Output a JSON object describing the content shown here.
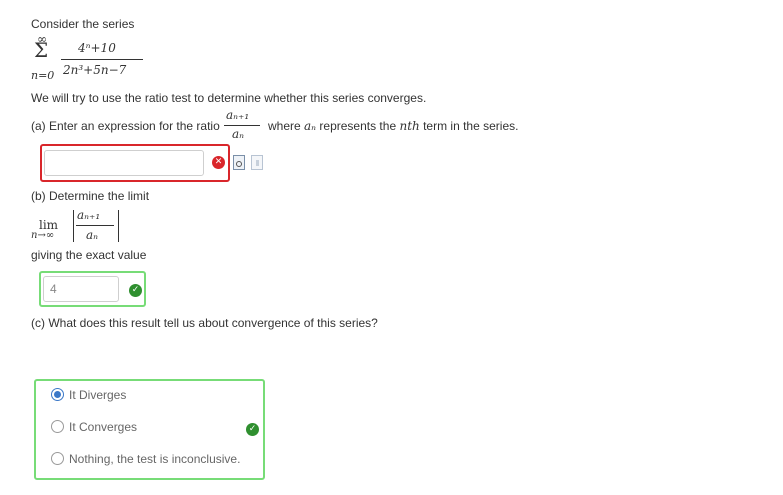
{
  "intro": "Consider the series",
  "series": {
    "sum_top": "∞",
    "sum_symbol": "Σ",
    "sum_bottom": "n=0",
    "numerator": "4ⁿ+10",
    "denominator": "2n³+5n−7"
  },
  "instructions": "We will try to use the ratio test to determine whether this series converges.",
  "part_a": {
    "text_before": "(a) Enter an expression for the ratio",
    "ratio_num": "aₙ₊₁",
    "ratio_den": "aₙ",
    "text_after_1": "where",
    "a_n": "aₙ",
    "text_after_2": "represents the",
    "nth": "nth",
    "text_after_3": "term in the series.",
    "input_value": "",
    "status": "incorrect",
    "status_glyph": "✕",
    "status_color": "#d9262b",
    "frame_color": "#d9262b",
    "icons": [
      "preview-icon",
      "help-icon"
    ]
  },
  "part_b": {
    "label": "(b) Determine the limit",
    "lim": "lim",
    "lim_sub": "n→∞",
    "ratio_num": "aₙ₊₁",
    "ratio_den": "aₙ",
    "note": "giving the exact value",
    "input_value": "4",
    "status": "correct",
    "status_glyph": "✓",
    "status_color": "#2f8f2f",
    "frame_color": "#77dc77"
  },
  "part_c": {
    "label": "(c) What does this result tell us about convergence of this series?",
    "options": [
      "It Diverges",
      "It Converges",
      "Nothing, the test is inconclusive."
    ],
    "selected_index": 0,
    "status": "correct",
    "status_glyph": "✓",
    "status_color": "#2f8f2f",
    "frame_color": "#77dc77"
  }
}
